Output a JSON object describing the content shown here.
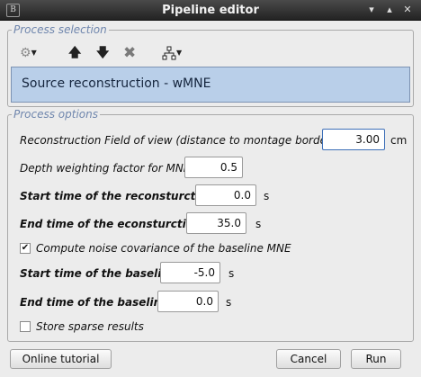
{
  "window": {
    "title": "Pipeline editor",
    "icon": "brainstorm-app-icon"
  },
  "process_selection": {
    "legend": "Process selection",
    "toolbar": [
      "gear-menu-icon",
      "move-up-icon",
      "move-down-icon",
      "delete-icon",
      "pipeline-tree-icon"
    ],
    "selected_process": "Source reconstruction - wMNE"
  },
  "process_options": {
    "legend": "Process options",
    "fov": {
      "label": "Reconstruction Field of view (distance to montage border)",
      "value": "3.00",
      "unit": "cm"
    },
    "depth": {
      "label": "Depth weighting factor for MNE",
      "value": "0.5"
    },
    "recon_start": {
      "label": "Start time of the reconsturction",
      "value": "0.0",
      "unit": "s"
    },
    "recon_end": {
      "label": "End time of the econsturction",
      "value": "35.0",
      "unit": "s"
    },
    "noise_cov": {
      "label": "Compute noise covariance of the baseline MNE",
      "checked": true
    },
    "baseline_start": {
      "label": "Start time of the baseline",
      "value": "-5.0",
      "unit": "s"
    },
    "baseline_end": {
      "label": "End time of the baseline",
      "value": "0.0",
      "unit": "s"
    },
    "sparse": {
      "label": "Store sparse results",
      "checked": false
    }
  },
  "buttons": {
    "tutorial": "Online tutorial",
    "cancel": "Cancel",
    "run": "Run"
  },
  "colors": {
    "titlebar": "#2e2e2e",
    "legend": "#6f86ad",
    "selection": "#b9cfe9"
  }
}
